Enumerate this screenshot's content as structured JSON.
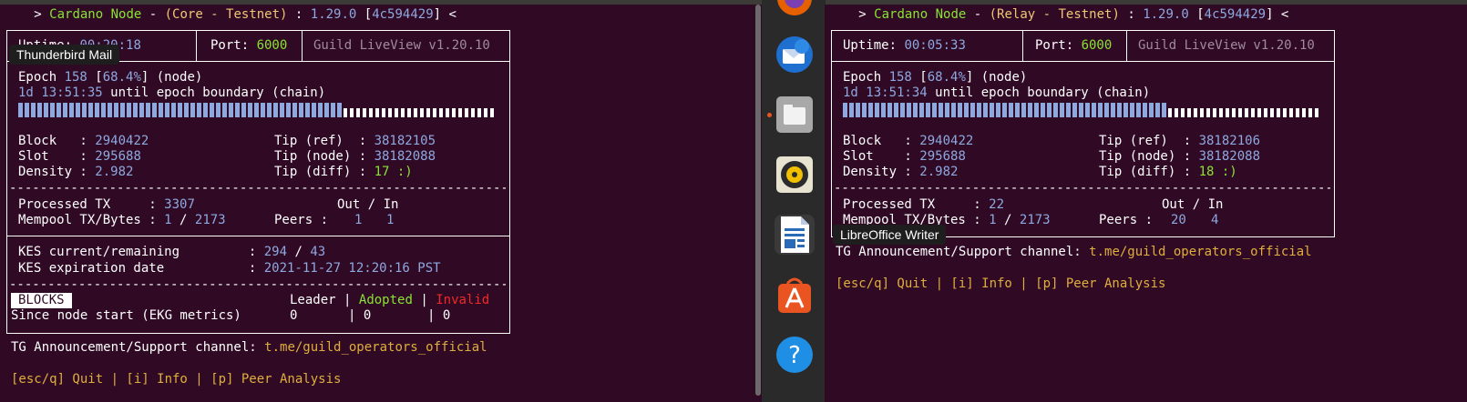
{
  "left": {
    "title_prefix": "   > ",
    "title_app": "Cardano Node",
    "title_dash": " - ",
    "title_mode": "(Core - Testnet)",
    "title_colon": " : ",
    "title_version": "1.29.0",
    "title_bracket_open": " [",
    "title_hash": "4c594429",
    "title_bracket_close": "] <",
    "uptime_label": "Uptime: ",
    "uptime_value": "00:20:18",
    "port_label": "Port: ",
    "port_value": "6000",
    "liveview": "Guild LiveView v1.20.10",
    "epoch_label": "Epoch ",
    "epoch_value": "158",
    "epoch_bracket_open": " [",
    "epoch_pct": "68.4%",
    "epoch_suffix": "] (node)",
    "epoch_time": "1d 13:51:35",
    "epoch_until": " until epoch boundary (chain)",
    "epoch_progress": 0.684,
    "block_label": "Block   : ",
    "block_value": "2940422",
    "slot_label": "Slot    : ",
    "slot_value": "295688",
    "density_label": "Density : ",
    "density_value": "2.982",
    "tipref_label": "Tip (ref)  : ",
    "tipref_value": "38182105",
    "tipnode_label": "Tip (node) : ",
    "tipnode_value": "38182088",
    "tipdiff_label": "Tip (diff) : ",
    "tipdiff_value": "17 :)",
    "processed_label": "Processed TX     : ",
    "processed_value": "3307",
    "outin_label": "Out / In",
    "mempool_label": "Mempool TX/Bytes : ",
    "mempool_tx": "1",
    "mempool_sep": " / ",
    "mempool_bytes": "2173",
    "peers_label": "Peers :",
    "peers_out": "1",
    "peers_in": "1",
    "kes_label": "KES current/remaining         : ",
    "kes_current": "294",
    "kes_sep": " / ",
    "kes_remaining": "43",
    "kesexp_label": "KES expiration date           : ",
    "kesexp_value": "2021-11-27 12:20:16 PST",
    "blocks_label": "BLOCKS",
    "leader_label": "Leader",
    "pipe": "|",
    "adopted_label": "Adopted",
    "invalid_label": "Invalid",
    "since_label": "Since node start (EKG metrics)",
    "leader_value": "0",
    "adopted_value": "0",
    "invalid_value": "0",
    "tg_label": "TG Announcement/Support channel: ",
    "tg_link": "t.me/guild_operators_official",
    "keys": "[esc/q] Quit | [i] Info | [p] Peer Analysis"
  },
  "right": {
    "title_prefix": "   > ",
    "title_app": "Cardano Node",
    "title_dash": " - ",
    "title_mode": "(Relay - Testnet)",
    "title_colon": " : ",
    "title_version": "1.29.0",
    "title_bracket_open": " [",
    "title_hash": "4c594429",
    "title_bracket_close": "] <",
    "uptime_label": "Uptime: ",
    "uptime_value": "00:05:33",
    "port_label": "Port: ",
    "port_value": "6000",
    "liveview": "Guild LiveView v1.20.10",
    "epoch_label": "Epoch ",
    "epoch_value": "158",
    "epoch_bracket_open": " [",
    "epoch_pct": "68.4%",
    "epoch_suffix": "] (node)",
    "epoch_time": "1d 13:51:34",
    "epoch_until": " until epoch boundary (chain)",
    "epoch_progress": 0.684,
    "block_label": "Block   : ",
    "block_value": "2940422",
    "slot_label": "Slot    : ",
    "slot_value": "295688",
    "density_label": "Density : ",
    "density_value": "2.982",
    "tipref_label": "Tip (ref)  : ",
    "tipref_value": "38182106",
    "tipnode_label": "Tip (node) : ",
    "tipnode_value": "38182088",
    "tipdiff_label": "Tip (diff) : ",
    "tipdiff_value": "18 :)",
    "processed_label": "Processed TX     : ",
    "processed_value": "22",
    "outin_label": "Out / In",
    "mempool_label": "Mempool TX/Bytes : ",
    "mempool_tx": "1",
    "mempool_sep": " / ",
    "mempool_bytes": "2173",
    "peers_label": "Peers :",
    "peers_out": "20",
    "peers_in": "4",
    "tg_label": "TG Announcement/Support channel: ",
    "tg_link": "t.me/guild_operators_official",
    "keys": "[esc/q] Quit | [i] Info | [p] Peer Analysis"
  },
  "dock": {
    "tooltip_thunderbird": "Thunderbird Mail",
    "tooltip_writer": "LibreOffice Writer",
    "help_glyph": "?",
    "colors": {
      "dock_bg": "#2a2a2a",
      "running_dot": "#e95420"
    }
  },
  "colors": {
    "terminal_bg": "#300a24",
    "green": "#8ae234",
    "yellow": "#f0c674",
    "blue": "#8ea8e0",
    "red": "#ef2929"
  }
}
